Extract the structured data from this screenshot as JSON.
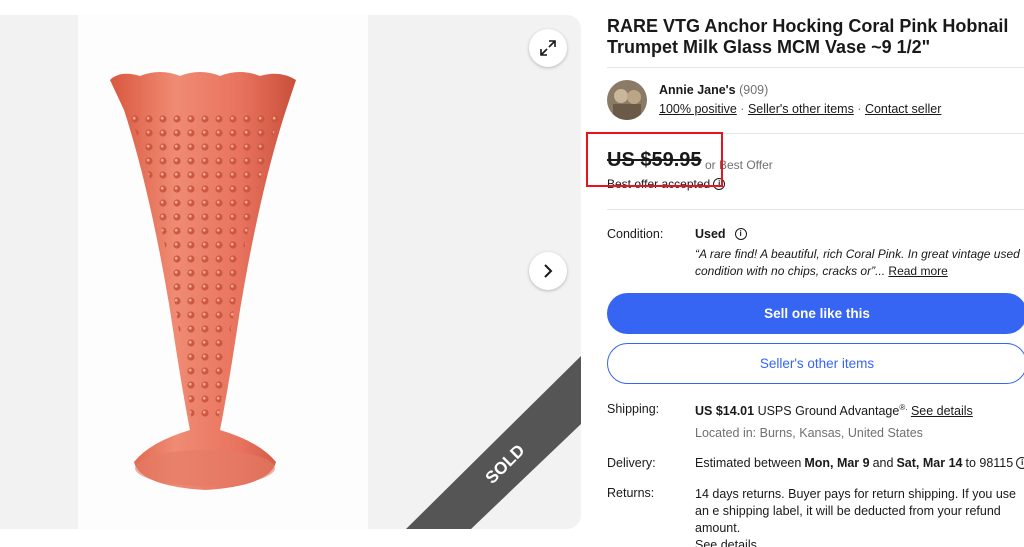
{
  "listing": {
    "title": "RARE VTG Anchor Hocking Coral Pink Hobnail Trumpet Milk Glass MCM Vase ~9 1/2\"",
    "sold_badge": "SOLD"
  },
  "seller": {
    "name": "Annie Jane's",
    "feedback_count": "(909)",
    "positive": "100% positive",
    "other_items_link": "Seller's other items",
    "contact_link": "Contact seller"
  },
  "price": {
    "amount": "US $59.95",
    "or_best_offer": "or Best Offer",
    "best_offer_accepted": "Best offer accepted"
  },
  "condition": {
    "label": "Condition:",
    "value": "Used",
    "quote": "“A rare find! A beautiful, rich Coral Pink. In great vintage used condition with no chips, cracks or”...",
    "read_more": "Read more"
  },
  "actions": {
    "sell_one": "Sell one like this",
    "seller_other_items": "Seller's other items"
  },
  "shipping": {
    "label": "Shipping:",
    "price": "US $14.01",
    "service": "USPS Ground Advantage",
    "reg": "®.",
    "see_details": "See details",
    "location": "Located in: Burns, Kansas, United States"
  },
  "delivery": {
    "label": "Delivery:",
    "prefix": "Estimated between",
    "start": "Mon, Mar 9",
    "and": "and",
    "end": "Sat, Mar 14",
    "to_zip": "to 98115"
  },
  "returns": {
    "label": "Returns:",
    "text": "14 days returns. Buyer pays for return shipping. If you use an e shipping label, it will be deducted from your refund amount.",
    "see_details": "See details"
  },
  "colors": {
    "primary": "#3665f3",
    "highlight_box": "#e8141d",
    "vase": "#e8735e"
  },
  "icons": {
    "expand": "expand-icon",
    "next": "chevron-right-icon",
    "info": "info-icon"
  }
}
